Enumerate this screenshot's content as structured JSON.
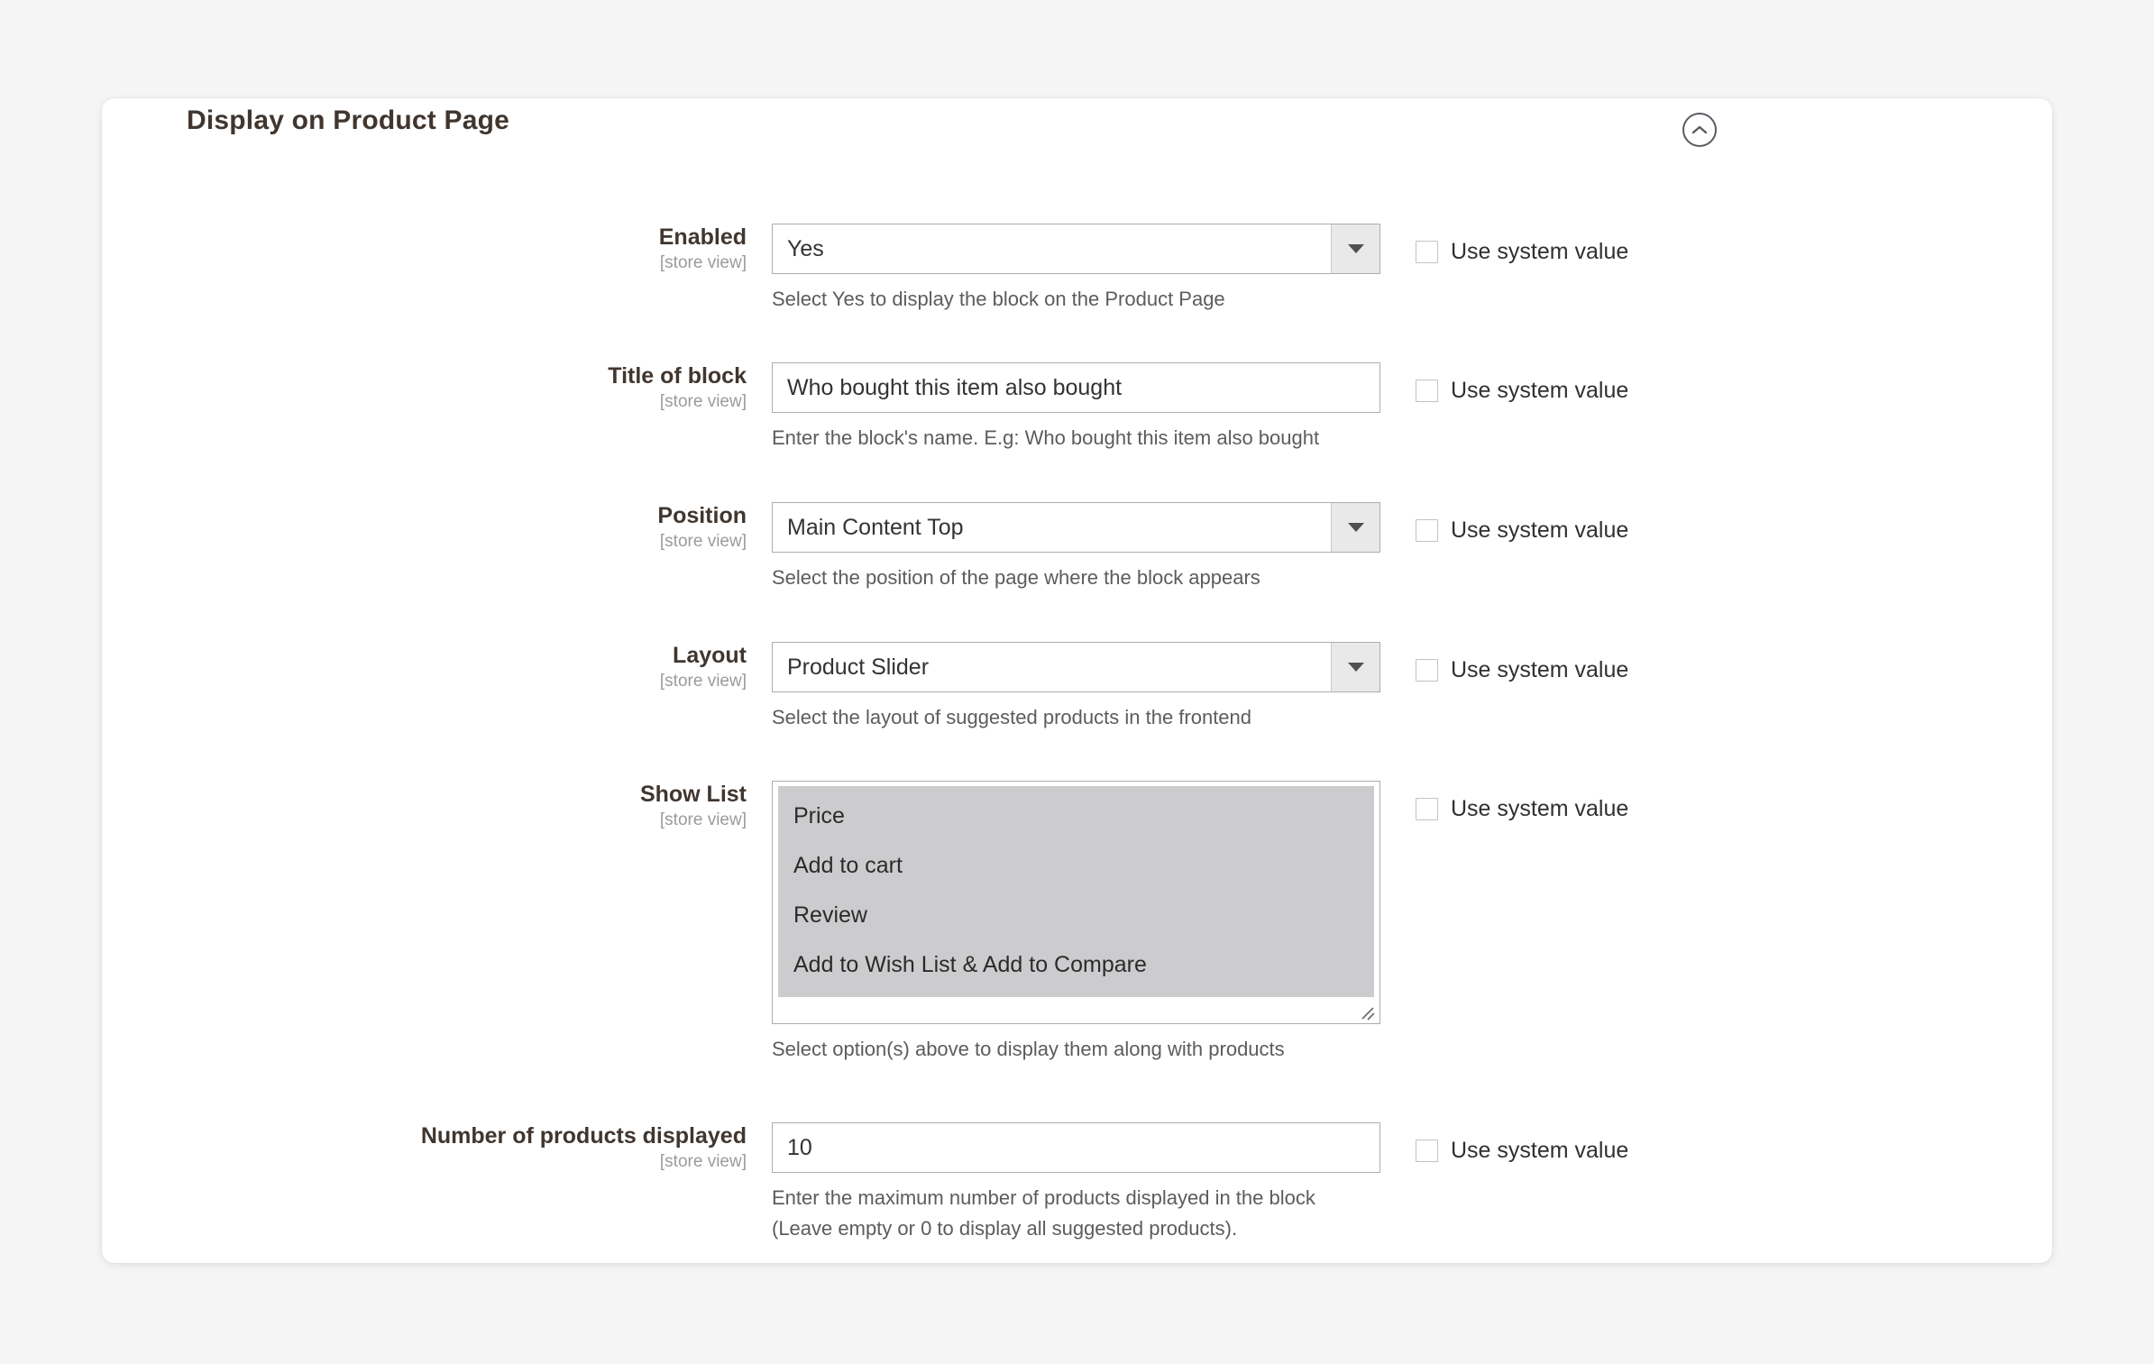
{
  "panel": {
    "title": "Display on Product Page",
    "collapse_icon": "chevron-up-circle-icon"
  },
  "common": {
    "scope_label": "[store view]",
    "use_system_value_label": "Use system value",
    "dropdown_icon": "chevron-down-icon",
    "resize_icon": "resize-handle-icon"
  },
  "fields": [
    {
      "key": "enabled",
      "label": "Enabled",
      "scope": "[store view]",
      "type": "select",
      "value": "Yes",
      "hint": [
        "Select Yes to display the block on the Product Page"
      ],
      "use_system_value": false
    },
    {
      "key": "title_of_block",
      "label": "Title of block",
      "scope": "[store view]",
      "type": "text",
      "value": "Who bought this item also bought",
      "placeholder": "",
      "hint": [
        "Enter the block's name. E.g: Who bought this item also bought"
      ],
      "use_system_value": false
    },
    {
      "key": "position",
      "label": "Position",
      "scope": "[store view]",
      "type": "select",
      "value": "Main Content Top",
      "hint": [
        "Select the position of the page where the block appears"
      ],
      "use_system_value": false
    },
    {
      "key": "layout",
      "label": "Layout",
      "scope": "[store view]",
      "type": "select",
      "value": "Product Slider",
      "hint": [
        "Select the layout of suggested products in the frontend"
      ],
      "use_system_value": false
    },
    {
      "key": "show_list",
      "label": "Show List",
      "scope": "[store view]",
      "type": "multiselect",
      "options": [
        "Price",
        "Add to cart",
        "Review",
        "Add to Wish List & Add to Compare"
      ],
      "selected": [
        "Price",
        "Add to cart",
        "Review",
        "Add to Wish List & Add to Compare"
      ],
      "hint": [
        "Select option(s) above to display them along with products"
      ],
      "use_system_value": false
    },
    {
      "key": "number_of_products_displayed",
      "label": "Number of products displayed",
      "scope": "[store view]",
      "type": "text",
      "value": "10",
      "placeholder": "",
      "hint": [
        "Enter the maximum number of products displayed in the block",
        "(Leave empty or 0 to display all suggested products)."
      ],
      "use_system_value": false
    }
  ],
  "colors": {
    "page_background": "#f5f5f5",
    "panel_background": "#ffffff",
    "label_text": "#41362f",
    "scope_text": "#9b9b9b",
    "hint_text": "#5c5c5c",
    "input_border": "#adadad",
    "select_button_background": "#e9e9e9",
    "multiselect_selected_background": "#ccccce"
  }
}
